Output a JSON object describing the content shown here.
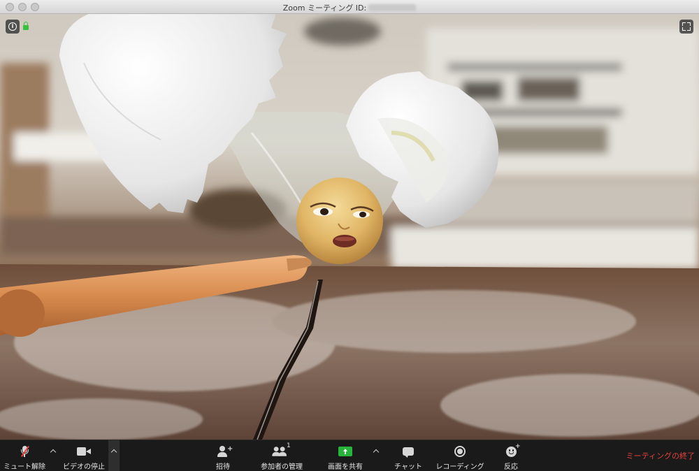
{
  "window": {
    "title": "Zoom ミーティング ID:"
  },
  "video": {
    "info_label": "i"
  },
  "toolbar": {
    "mute_label": "ミュート解除",
    "video_label": "ビデオの停止",
    "invite_label": "招待",
    "participants_label": "参加者の管理",
    "participants_count": "1",
    "share_label": "画面を共有",
    "chat_label": "チャット",
    "record_label": "レコーディング",
    "reactions_label": "反応",
    "end_label": "ミーティングの終了"
  },
  "colors": {
    "end_red": "#e8413c",
    "share_green": "#27b43a",
    "muted_red": "#e8413c",
    "lock_green": "#37c23c"
  }
}
